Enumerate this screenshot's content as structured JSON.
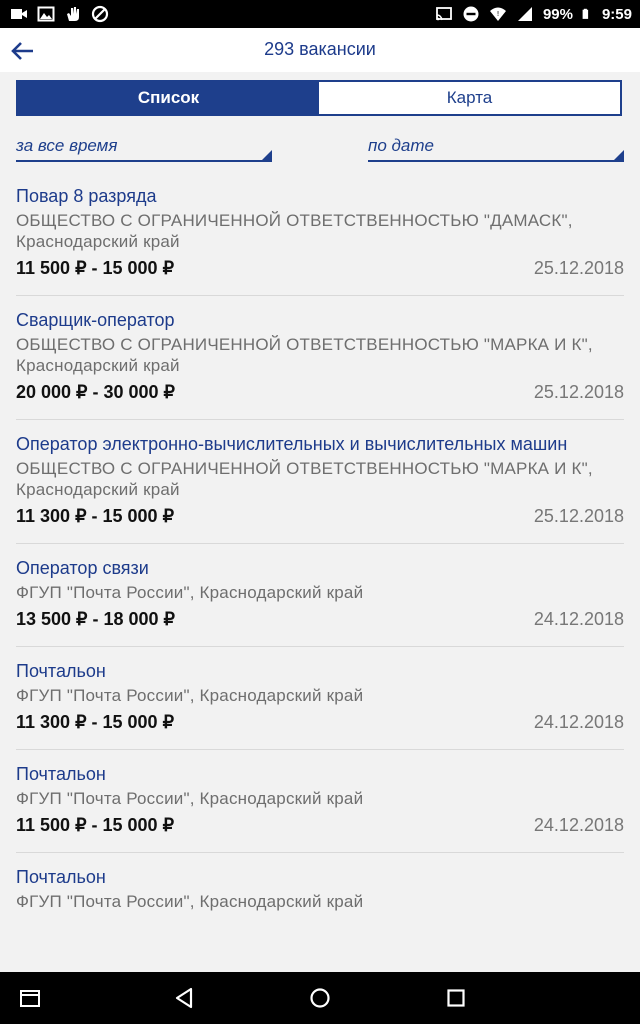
{
  "status": {
    "battery": "99%",
    "time": "9:59"
  },
  "header": {
    "title": "293 вакансии"
  },
  "tabs": [
    {
      "label": "Список"
    },
    {
      "label": "Карта"
    }
  ],
  "filters": {
    "period": "за все время",
    "sort": "по дате"
  },
  "vacancies": [
    {
      "title": "Повар 8 разряда",
      "employer": "ОБЩЕСТВО С ОГРАНИЧЕННОЙ ОТВЕТСТВЕННОСТЬЮ \"ДАМАСК\", Краснодарский край",
      "salary": "11 500 ₽ - 15 000 ₽",
      "date": "25.12.2018"
    },
    {
      "title": "Сварщик-оператор",
      "employer": "ОБЩЕСТВО С ОГРАНИЧЕННОЙ ОТВЕТСТВЕННОСТЬЮ \"МАРКА И К\", Краснодарский край",
      "salary": "20 000 ₽ - 30 000 ₽",
      "date": "25.12.2018"
    },
    {
      "title": "Оператор электронно-вычислительных и вычислительных машин",
      "employer": "ОБЩЕСТВО С ОГРАНИЧЕННОЙ ОТВЕТСТВЕННОСТЬЮ \"МАРКА И К\", Краснодарский край",
      "salary": "11 300 ₽ - 15 000 ₽",
      "date": "25.12.2018"
    },
    {
      "title": "Оператор связи",
      "employer": "ФГУП \"Почта России\", Краснодарский край",
      "salary": "13 500 ₽ - 18 000 ₽",
      "date": "24.12.2018"
    },
    {
      "title": "Почтальон",
      "employer": "ФГУП \"Почта России\", Краснодарский край",
      "salary": "11 300 ₽ - 15 000 ₽",
      "date": "24.12.2018"
    },
    {
      "title": "Почтальон",
      "employer": "ФГУП \"Почта России\", Краснодарский край",
      "salary": "11 500 ₽ - 15 000 ₽",
      "date": "24.12.2018"
    },
    {
      "title": "Почтальон",
      "employer": "ФГУП \"Почта России\", Краснодарский край",
      "salary": "",
      "date": ""
    }
  ]
}
